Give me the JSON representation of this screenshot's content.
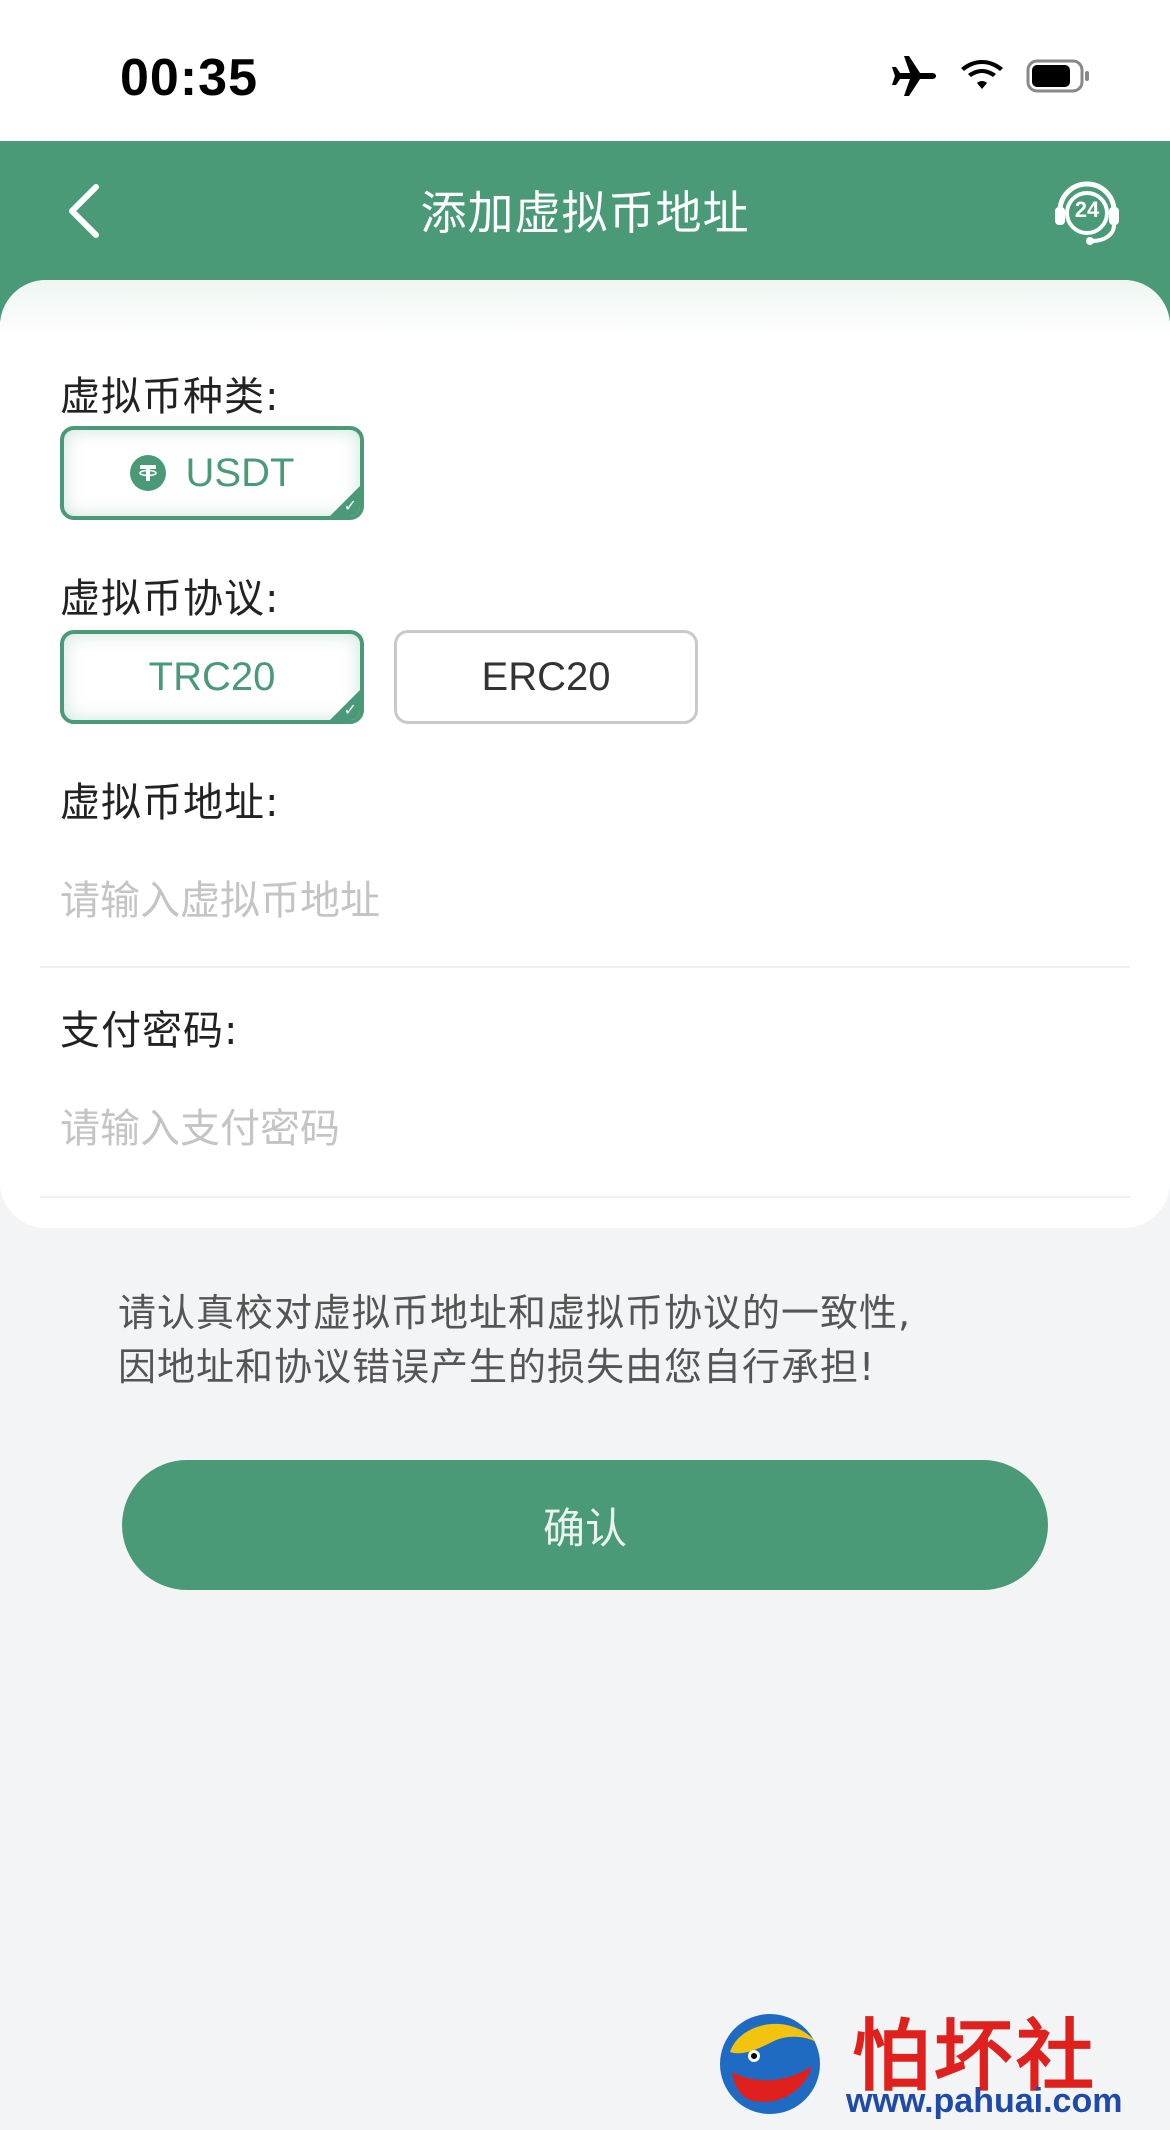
{
  "status_bar": {
    "time": "00:35",
    "icons": [
      "airplane-icon",
      "wifi-icon",
      "battery-icon"
    ]
  },
  "header": {
    "title": "添加虚拟币地址",
    "back_icon": "chevron-left-icon",
    "support_icon": "support-24h-icon",
    "support_text": "24",
    "background_color": "#4a9a78"
  },
  "form": {
    "coin_type": {
      "label": "虚拟币种类:",
      "options": [
        {
          "label": "USDT",
          "selected": true,
          "icon": "tether-icon"
        }
      ]
    },
    "protocol": {
      "label": "虚拟币协议:",
      "options": [
        {
          "label": "TRC20",
          "selected": true
        },
        {
          "label": "ERC20",
          "selected": false
        }
      ]
    },
    "address": {
      "label": "虚拟币地址:",
      "placeholder": "请输入虚拟币地址",
      "value": ""
    },
    "pay_password": {
      "label": "支付密码:",
      "placeholder": "请输入支付密码",
      "value": ""
    }
  },
  "notice": {
    "line1": "请认真校对虚拟币地址和虚拟币协议的一致性,",
    "line2": "因地址和协议错误产生的损失由您自行承担!"
  },
  "confirm_label": "确认",
  "watermark": {
    "text": "怕坏社区",
    "url": "www.pahuai.com"
  },
  "colors": {
    "accent": "#4a9a78",
    "page_bg": "#f3f4f6"
  }
}
